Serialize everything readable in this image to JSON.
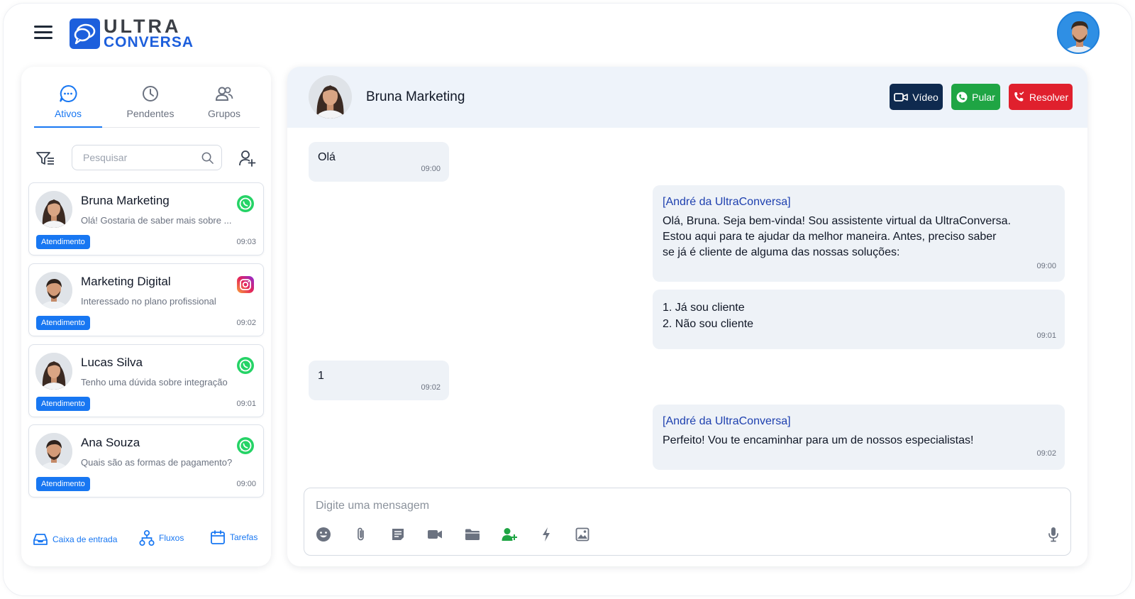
{
  "app": {
    "logo_line1": "ULTRA",
    "logo_line2": "CONVERSA",
    "brand_color": "#1d5fdc",
    "accent_color": "#1877f2"
  },
  "sidebar": {
    "tabs": [
      {
        "label": "Ativos",
        "icon": "chat-bubble-icon",
        "active": true
      },
      {
        "label": "Pendentes",
        "icon": "clock-icon",
        "active": false
      },
      {
        "label": "Grupos",
        "icon": "group-icon",
        "active": false
      }
    ],
    "search_placeholder": "Pesquisar",
    "conversations": [
      {
        "name": "Bruna Marketing",
        "preview": "Olá! Gostaria de saber mais sobre ...",
        "badge": "Atendimento",
        "time": "09:03",
        "channel": "whatsapp-icon"
      },
      {
        "name": "Marketing Digital",
        "preview": "Interessado no plano profissional",
        "badge": "Atendimento",
        "time": "09:02",
        "channel": "instagram-icon"
      },
      {
        "name": "Lucas Silva",
        "preview": "Tenho uma dúvida sobre integração",
        "badge": "Atendimento",
        "time": "09:01",
        "channel": "whatsapp-icon"
      },
      {
        "name": "Ana Souza",
        "preview": "Quais são as formas de pagamento?",
        "badge": "Atendimento",
        "time": "09:00",
        "channel": "whatsapp-icon"
      }
    ],
    "bottom_nav": [
      {
        "label": "Caixa de entrada",
        "icon": "inbox-icon"
      },
      {
        "label": "Fluxos",
        "icon": "flow-icon"
      },
      {
        "label": "Tarefas",
        "icon": "calendar-icon"
      }
    ]
  },
  "chat": {
    "contact_name": "Bruna Marketing",
    "buttons": {
      "video": "Vídeo",
      "pular": "Pular",
      "resolver": "Resolver"
    },
    "button_colors": {
      "video": "#0f2a4f",
      "pular": "#1fa544",
      "resolver": "#e0202d"
    },
    "messages": [
      {
        "direction": "in",
        "text": "Olá",
        "time": "09:00"
      },
      {
        "direction": "out",
        "sender": "[André da UltraConversa]",
        "lines": [
          "Olá, Bruna. Seja bem-vinda! Sou assistente virtual da UltraConversa.",
          "Estou aqui para te ajudar da melhor maneira. Antes, preciso saber",
          "se já é cliente de alguma das nossas soluções:"
        ],
        "time": "09:00"
      },
      {
        "direction": "out",
        "lines": [
          "1. Já sou cliente",
          "2. Não sou cliente"
        ],
        "time": "09:01"
      },
      {
        "direction": "in",
        "text": "1",
        "time": "09:02"
      },
      {
        "direction": "out",
        "sender": "[André da UltraConversa]",
        "lines": [
          "Perfeito! Vou te encaminhar para um de nossos especialistas!"
        ],
        "time": "09:02"
      }
    ],
    "composer_placeholder": "Digite uma mensagem",
    "composer_tools": [
      "emoji-icon",
      "attachment-icon",
      "note-icon",
      "video-icon",
      "folder-icon",
      "add-contact-icon",
      "lightning-icon",
      "image-icon",
      "microphone-icon"
    ]
  }
}
